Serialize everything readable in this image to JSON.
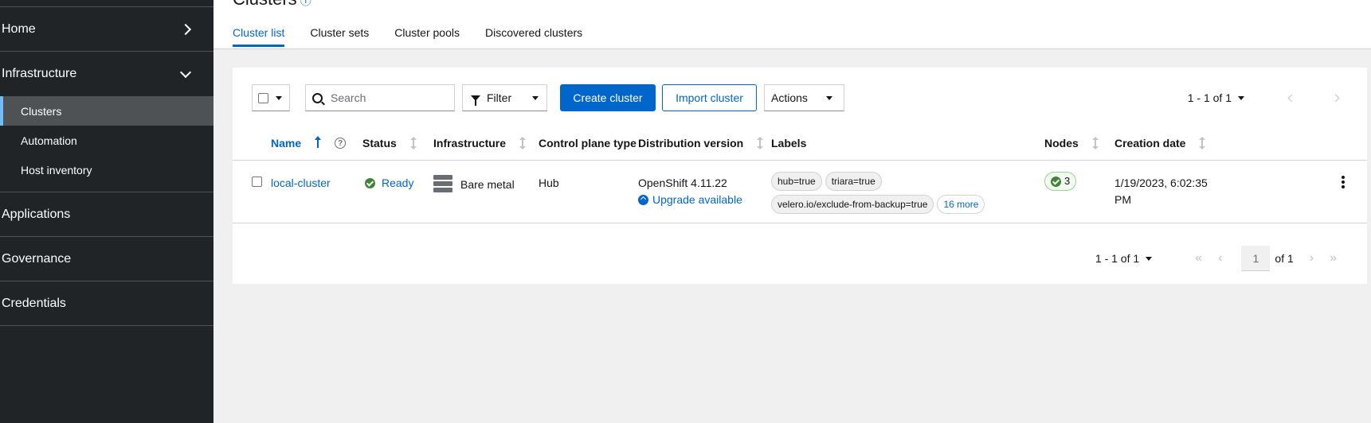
{
  "sidebar": {
    "groups": [
      {
        "label": "Home",
        "expanded": false
      },
      {
        "label": "Infrastructure",
        "expanded": true,
        "items": [
          "Clusters",
          "Automation",
          "Host inventory"
        ]
      },
      {
        "label": "Applications"
      },
      {
        "label": "Governance"
      },
      {
        "label": "Credentials"
      }
    ],
    "active_item": "Clusters"
  },
  "header": {
    "title": "Clusters"
  },
  "tabs": [
    "Cluster list",
    "Cluster sets",
    "Cluster pools",
    "Discovered clusters"
  ],
  "active_tab": "Cluster list",
  "toolbar": {
    "search_placeholder": "Search",
    "filter_label": "Filter",
    "create_label": "Create cluster",
    "import_label": "Import cluster",
    "actions_label": "Actions",
    "pagination_count": "1 - 1 of 1"
  },
  "table": {
    "columns": [
      "Name",
      "Status",
      "Infrastructure",
      "Control plane type",
      "Distribution version",
      "Labels",
      "Nodes",
      "Creation date"
    ],
    "rows": [
      {
        "name": "local-cluster",
        "status": "Ready",
        "infrastructure": "Bare metal",
        "control_plane": "Hub",
        "distribution": "OpenShift 4.11.22",
        "upgrade": "Upgrade available",
        "labels": [
          "hub=true",
          "triara=true",
          "velero.io/exclude-from-backup=true"
        ],
        "labels_more": "16 more",
        "nodes": "3",
        "creation_date_line1": "1/19/2023, 6:02:35",
        "creation_date_line2": "PM"
      }
    ]
  },
  "pagination": {
    "count": "1 - 1 of 1",
    "page": "1",
    "of_pages": "of 1"
  },
  "colors": {
    "accent": "#0066cc",
    "sidebar_bg": "#212427",
    "success": "#3e8635"
  },
  "icons": [
    "chevron-right-icon",
    "chevron-down-icon",
    "search-icon",
    "filter-icon",
    "help-icon",
    "check-circle-icon",
    "server-icon",
    "arrow-up-circle-icon",
    "kebab-icon"
  ]
}
